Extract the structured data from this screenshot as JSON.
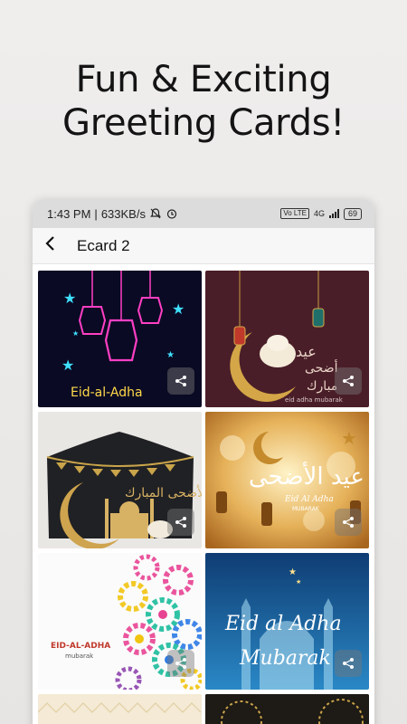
{
  "headline": {
    "line1": "Fun & Exciting",
    "line2": "Greeting Cards!"
  },
  "status": {
    "time": "1:43 PM",
    "speed": "633KB/s",
    "net": "4G",
    "vo": "Vo LTE",
    "battery": "69"
  },
  "appbar": {
    "title": "Ecard 2"
  },
  "cards": [
    {
      "text": "Eid-al-Adha",
      "arabic": "",
      "share": "share-icon"
    },
    {
      "text": "eid adha mubarak",
      "arabic": "عيد أضحى مبارك",
      "share": "share-icon"
    },
    {
      "text": "",
      "arabic": "عيد الأضحى المبارك",
      "share": "share-icon"
    },
    {
      "text": "Eid Al Adha",
      "sub": "MUBARAK",
      "arabic": "عيد الأضحى",
      "share": "share-icon"
    },
    {
      "text": "EID-AL-ADHA",
      "sub": "mubarak",
      "arabic": "",
      "share": "share-icon"
    },
    {
      "text": "Eid al Adha",
      "sub": "Mubarak",
      "arabic": "",
      "share": "share-icon"
    }
  ],
  "colors": {
    "statusbar": "#dcdcdc",
    "appbar": "#f7f7f7",
    "background": "#eceae8"
  }
}
